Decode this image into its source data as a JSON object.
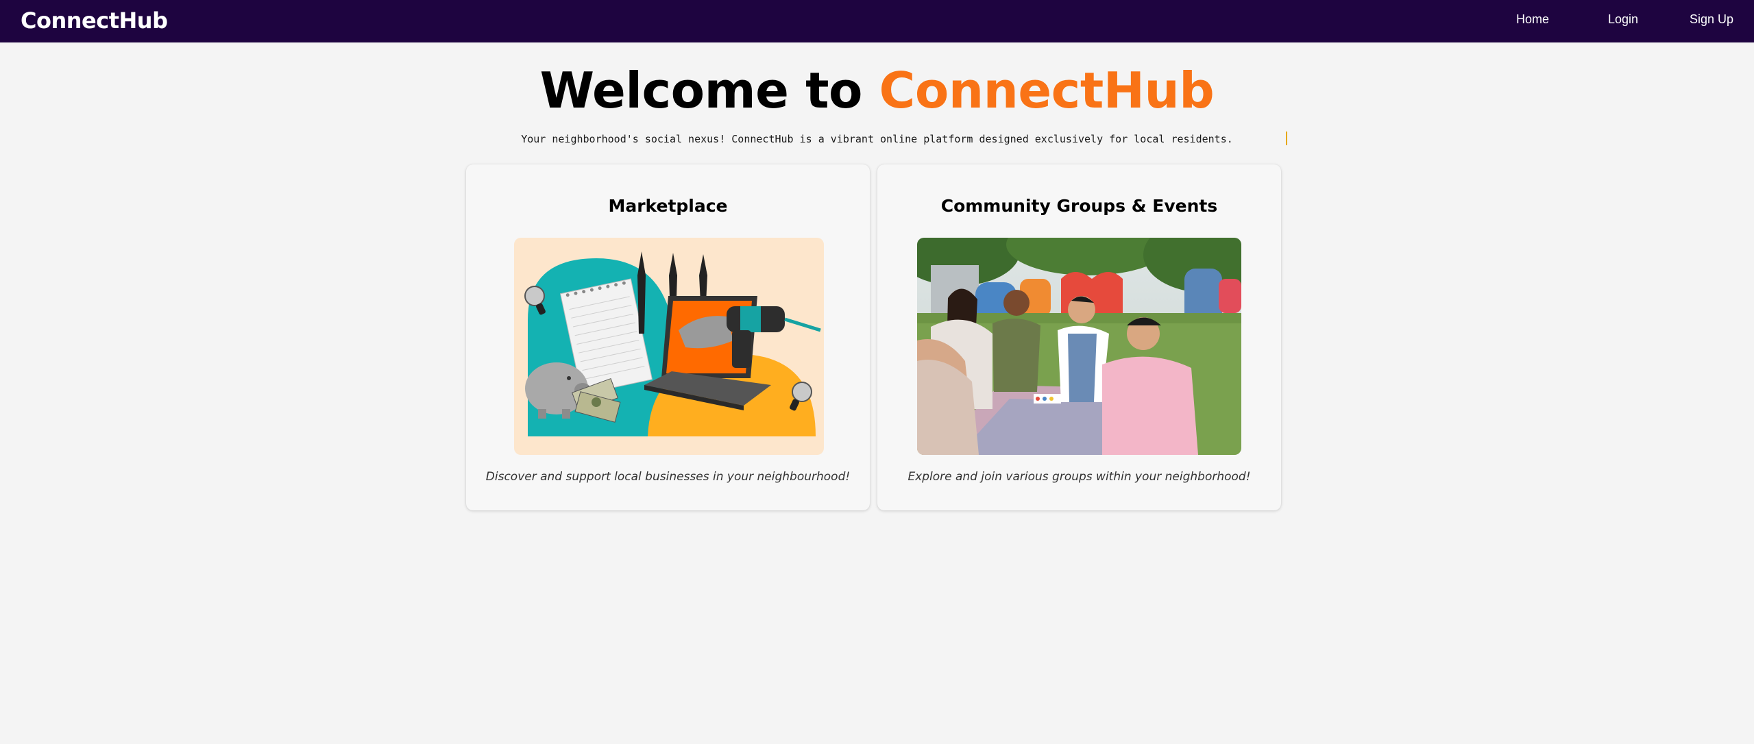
{
  "nav": {
    "brand": "ConnectHub",
    "links": [
      "Home",
      "Login",
      "Sign Up"
    ]
  },
  "hero": {
    "title_prefix": "Welcome to",
    "title_accent": "ConnectHub",
    "tagline": "Your neighborhood's social nexus! ConnectHub is a vibrant online platform designed exclusively for local residents."
  },
  "cards": [
    {
      "title": "Marketplace",
      "description": "Discover and support local businesses in your neighbourhood!"
    },
    {
      "title": "Community Groups & Events",
      "description": "Explore and join various groups within your neighborhood!"
    }
  ],
  "colors": {
    "nav_bg": "#1e0440",
    "accent": "#f97316",
    "page_bg": "#f4f4f4",
    "caret": "#e6a800"
  }
}
